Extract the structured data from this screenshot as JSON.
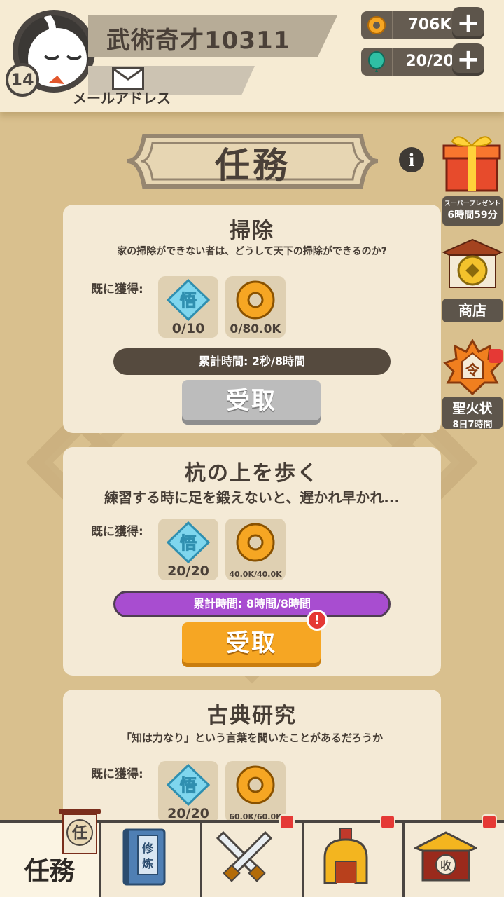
{
  "player": {
    "name": "武術奇才10311",
    "level": "14",
    "mail_label": "メールアドレス"
  },
  "resources": {
    "coins": "706K",
    "energy": "20/20"
  },
  "page": {
    "title": "任務"
  },
  "side_buttons": {
    "gift": {
      "label": "スーパープレゼント",
      "timer": "6時間59分"
    },
    "shop": {
      "label": "商店"
    },
    "token": {
      "label": "聖火状",
      "timer": "8日7時間"
    }
  },
  "tasks": [
    {
      "title": "掃除",
      "desc": "家の掃除ができない者は、どうして天下の掃除ができるのか?",
      "earned_label": "既に獲得:",
      "reward_enlight_icon": "悟",
      "reward_enlight": "0/10",
      "reward_coin": "0/80.0K",
      "time": "累計時間: 2秒/8時間",
      "claim": "受取",
      "claim_progress": 0.0001
    },
    {
      "title": "杭の上を歩く",
      "desc": "練習する時に足を鍛えないと、遅かれ早かれ...",
      "earned_label": "既に獲得:",
      "reward_enlight_icon": "悟",
      "reward_enlight": "20/20",
      "reward_coin": "40.0K/40.0K",
      "time": "累計時間: 8時間/8時間",
      "claim": "受取",
      "alert": "!"
    },
    {
      "title": "古典研究",
      "desc": "「知は力なり」という言葉を聞いたことがあるだろうか",
      "earned_label": "既に獲得:",
      "reward_enlight_icon": "悟",
      "reward_enlight": "20/20",
      "reward_coin": "60.0K/60.0K"
    }
  ],
  "nav": {
    "tasks_icon_char": "任",
    "tasks_label": "任務",
    "train_icon_text": "修炼",
    "collect_icon_char": "收"
  },
  "token_icon_char": "令"
}
